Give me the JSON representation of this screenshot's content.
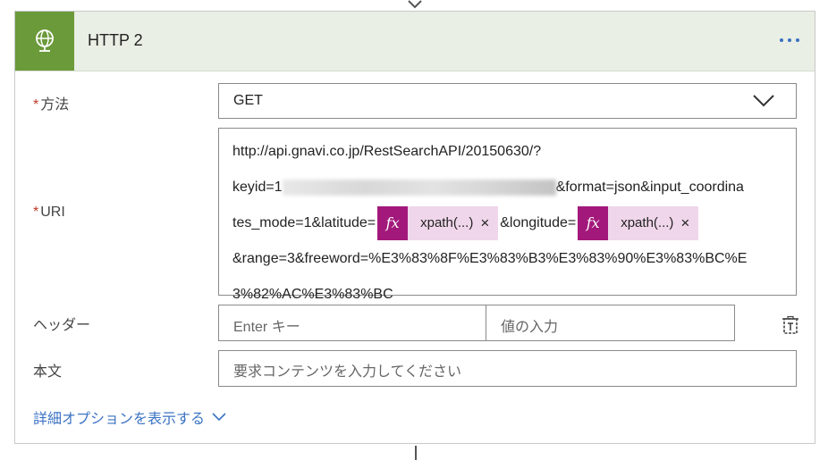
{
  "card": {
    "title": "HTTP 2",
    "icon": "globe-icon",
    "accent_color": "#6b9a3a",
    "header_bg": "#e9efe4"
  },
  "fields": {
    "method": {
      "label": "方法",
      "required_mark": "*",
      "value": "GET"
    },
    "uri": {
      "label": "URI",
      "required_mark": "*",
      "line1": "http://api.gnavi.co.jp/RestSearchAPI/20150630/?",
      "line2_prefix": "keyid=1",
      "line2_suffix": "&format=json&input_coordina",
      "line3_prefix": "tes_mode=1&latitude=",
      "token1_label": "xpath(...)",
      "line3_middle": "&longitude=",
      "token2_label": "xpath(...)",
      "line4": "&range=3&freeword=%E3%83%8F%E3%83%B3%E3%83%90%E3%83%BC%E",
      "line5": "3%82%AC%E3%83%BC",
      "token_icon_text": "fx",
      "token_color": "#a3197b"
    },
    "headers": {
      "label": "ヘッダー",
      "key_placeholder": "Enter キー",
      "value_placeholder": "値の入力"
    },
    "body": {
      "label": "本文",
      "placeholder": "要求コンテンツを入力してください"
    }
  },
  "advanced_options_link": "詳細オプションを表示する",
  "link_color": "#3b73c3"
}
